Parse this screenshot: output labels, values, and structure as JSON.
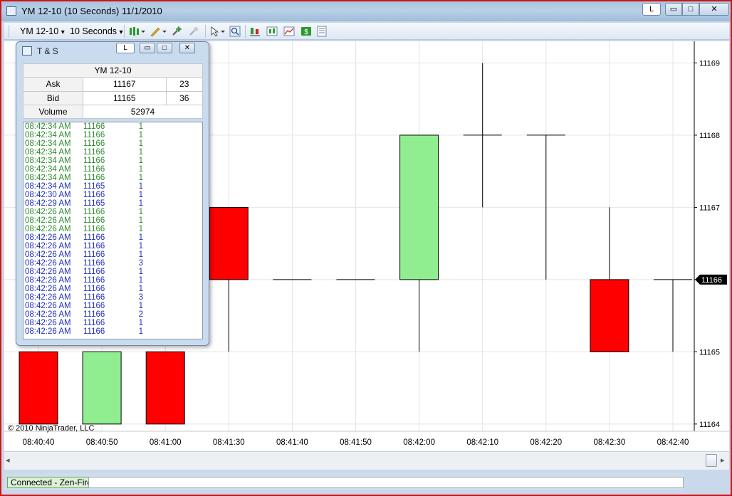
{
  "window": {
    "title": "YM 12-10 (10 Seconds)  11/1/2010",
    "link_label": "L",
    "min_glyph": "▭",
    "max_glyph": "□",
    "close_glyph": "✕"
  },
  "toolbar": {
    "instrument": "YM 12-10",
    "interval": "10 Seconds",
    "dropdown_glyph": "▾",
    "icons": [
      "chart-style-icon",
      "draw-pencil-icon",
      "add-indicator-icon",
      "remove-indicator-icon",
      "pointer-cursor-icon",
      "zoom-icon",
      "strategies-icon",
      "indicators-icon",
      "data-series-icon",
      "dollar-icon",
      "properties-icon"
    ]
  },
  "colors": {
    "up_candle": "#90ee90",
    "down_candle": "#ff0000",
    "buy_trade": "#2e8b2e",
    "sell_trade": "#1f2fbf",
    "price_marker": "#000000"
  },
  "chart_data": {
    "type": "candlestick",
    "x": [
      "08:40:40",
      "08:40:50",
      "08:41:00",
      "08:41:30",
      "08:41:40",
      "08:41:50",
      "08:42:00",
      "08:42:10",
      "08:42:20",
      "08:42:30",
      "08:42:40"
    ],
    "candles": [
      {
        "x": "08:40:40",
        "open": 11165,
        "high": 11165,
        "low": 11164,
        "close": 11164
      },
      {
        "x": "08:40:50",
        "open": 11164,
        "high": 11165,
        "low": 11164,
        "close": 11165
      },
      {
        "x": "08:41:00",
        "open": 11165,
        "high": 11165,
        "low": 11164,
        "close": 11164
      },
      {
        "x": "08:41:30",
        "open": 11167,
        "high": 11167,
        "low": 11165,
        "close": 11166
      },
      {
        "x": "08:41:40",
        "open": 11166,
        "high": 11166,
        "low": 11166,
        "close": 11166
      },
      {
        "x": "08:41:50",
        "open": 11166,
        "high": 11166,
        "low": 11166,
        "close": 11166
      },
      {
        "x": "08:42:00",
        "open": 11166,
        "high": 11168,
        "low": 11165,
        "close": 11168
      },
      {
        "x": "08:42:10",
        "open": 11168,
        "high": 11169,
        "low": 11167,
        "close": 11168
      },
      {
        "x": "08:42:20",
        "open": 11168,
        "high": 11168,
        "low": 11166,
        "close": 11168
      },
      {
        "x": "08:42:30",
        "open": 11166,
        "high": 11167,
        "low": 11165,
        "close": 11165
      },
      {
        "x": "08:42:40",
        "open": 11166,
        "high": 11166,
        "low": 11165,
        "close": 11166
      }
    ],
    "y_ticks": [
      11164,
      11165,
      11166,
      11167,
      11168,
      11169
    ],
    "ylim": [
      11163.9,
      11169.3
    ],
    "last_price": 11166,
    "last_price_label": "11166",
    "grid": true,
    "copyright": "© 2010 NinjaTrader, LLC"
  },
  "ts_window": {
    "title": "T & S",
    "link_label": "L",
    "min_glyph": "▭",
    "max_glyph": "□",
    "close_glyph": "✕",
    "instrument": "YM 12-10",
    "ask_label": "Ask",
    "ask_price": "11167",
    "ask_size": "23",
    "bid_label": "Bid",
    "bid_price": "11165",
    "bid_size": "36",
    "volume_label": "Volume",
    "volume": "52974",
    "trades": [
      {
        "time": "08:42:34 AM",
        "price": "11166",
        "qty": "1",
        "side": "buy"
      },
      {
        "time": "08:42:34 AM",
        "price": "11166",
        "qty": "1",
        "side": "buy"
      },
      {
        "time": "08:42:34 AM",
        "price": "11166",
        "qty": "1",
        "side": "buy"
      },
      {
        "time": "08:42:34 AM",
        "price": "11166",
        "qty": "1",
        "side": "buy"
      },
      {
        "time": "08:42:34 AM",
        "price": "11166",
        "qty": "1",
        "side": "buy"
      },
      {
        "time": "08:42:34 AM",
        "price": "11166",
        "qty": "1",
        "side": "buy"
      },
      {
        "time": "08:42:34 AM",
        "price": "11166",
        "qty": "1",
        "side": "buy"
      },
      {
        "time": "08:42:34 AM",
        "price": "11165",
        "qty": "1",
        "side": "sell"
      },
      {
        "time": "08:42:30 AM",
        "price": "11166",
        "qty": "1",
        "side": "sell"
      },
      {
        "time": "08:42:29 AM",
        "price": "11165",
        "qty": "1",
        "side": "sell"
      },
      {
        "time": "08:42:26 AM",
        "price": "11166",
        "qty": "1",
        "side": "buy"
      },
      {
        "time": "08:42:26 AM",
        "price": "11166",
        "qty": "1",
        "side": "buy"
      },
      {
        "time": "08:42:26 AM",
        "price": "11166",
        "qty": "1",
        "side": "buy"
      },
      {
        "time": "08:42:26 AM",
        "price": "11166",
        "qty": "1",
        "side": "sell"
      },
      {
        "time": "08:42:26 AM",
        "price": "11166",
        "qty": "1",
        "side": "sell"
      },
      {
        "time": "08:42:26 AM",
        "price": "11166",
        "qty": "1",
        "side": "sell"
      },
      {
        "time": "08:42:26 AM",
        "price": "11166",
        "qty": "3",
        "side": "sell"
      },
      {
        "time": "08:42:26 AM",
        "price": "11166",
        "qty": "1",
        "side": "sell"
      },
      {
        "time": "08:42:26 AM",
        "price": "11166",
        "qty": "1",
        "side": "sell"
      },
      {
        "time": "08:42:26 AM",
        "price": "11166",
        "qty": "1",
        "side": "sell"
      },
      {
        "time": "08:42:26 AM",
        "price": "11166",
        "qty": "3",
        "side": "sell"
      },
      {
        "time": "08:42:26 AM",
        "price": "11166",
        "qty": "1",
        "side": "sell"
      },
      {
        "time": "08:42:26 AM",
        "price": "11166",
        "qty": "2",
        "side": "sell"
      },
      {
        "time": "08:42:26 AM",
        "price": "11166",
        "qty": "1",
        "side": "sell"
      },
      {
        "time": "08:42:26 AM",
        "price": "11166",
        "qty": "1",
        "side": "sell"
      }
    ]
  },
  "statusbar": {
    "connection": "Connected - Zen-Fire"
  }
}
